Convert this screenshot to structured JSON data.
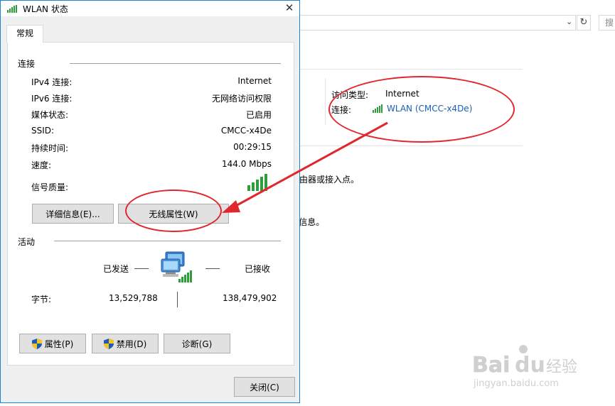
{
  "dialog": {
    "title": "WLAN 状态",
    "close_glyph": "✕",
    "tab": "常规",
    "connection": {
      "section_title": "连接",
      "rows": [
        {
          "label": "IPv4 连接:",
          "value": "Internet"
        },
        {
          "label": "IPv6 连接:",
          "value": "无网络访问权限"
        },
        {
          "label": "媒体状态:",
          "value": "已启用"
        },
        {
          "label": "SSID:",
          "value": "CMCC-x4De"
        },
        {
          "label": "持续时间:",
          "value": "00:29:15"
        },
        {
          "label": "速度:",
          "value": "144.0 Mbps"
        }
      ],
      "signal_label": "信号质量:",
      "signal_icon": "signal-bars-icon",
      "details_button": "详细信息(E)...",
      "wireless_props_button": "无线属性(W)"
    },
    "activity": {
      "section_title": "活动",
      "sent_label": "已发送",
      "received_label": "已接收",
      "bytes_label": "字节:",
      "bytes_sent": "13,529,788",
      "bytes_received": "138,479,902"
    },
    "buttons": {
      "properties": "属性(P)",
      "disable": "禁用(D)",
      "diagnose": "诊断(G)",
      "close": "关闭(C)"
    }
  },
  "background": {
    "search_placeholder": "搜",
    "access_type_label": "访问类型:",
    "access_type_value": "Internet",
    "connection_label": "连接:",
    "connection_link": "WLAN (CMCC-x4De)",
    "text_fragment_1": "由器或接入点。",
    "text_fragment_2": "f信息。"
  },
  "watermark": {
    "brand": "Baidu经验",
    "url": "jingyan.baidu.com"
  },
  "colors": {
    "annotation_red": "#e0272d",
    "link_blue": "#1a5fb4",
    "signal_green": "#2e9e3a",
    "dialog_border": "#1883d7"
  }
}
